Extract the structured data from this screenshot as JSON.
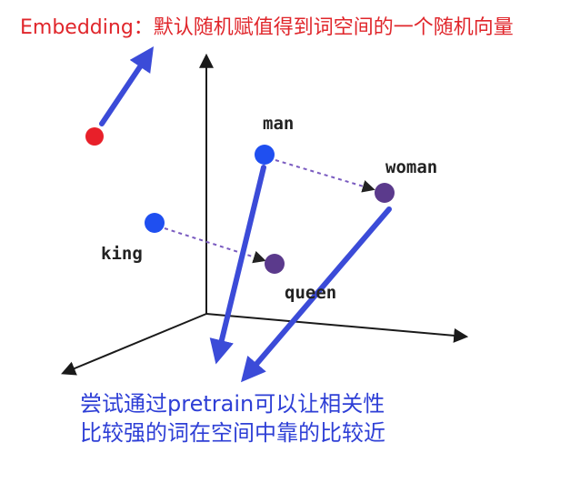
{
  "title": "Embedding：默认随机赋值得到词空间的一个随机向量",
  "note": {
    "line1": "尝试通过pretrain可以让相关性",
    "line2": "比较强的词在空间中靠的比较近"
  },
  "words": {
    "man": "man",
    "woman": "woman",
    "king": "king",
    "queen": "queen"
  },
  "colors": {
    "title": "#e0262b",
    "note": "#2e3fd6",
    "arrow": "#3b4bd8",
    "random_point": "#e8202a",
    "blue_point": "#1f4ff0",
    "purple_point": "#5b3a8c",
    "axis": "#1a1a1a",
    "relation": "#7a5bc0"
  }
}
